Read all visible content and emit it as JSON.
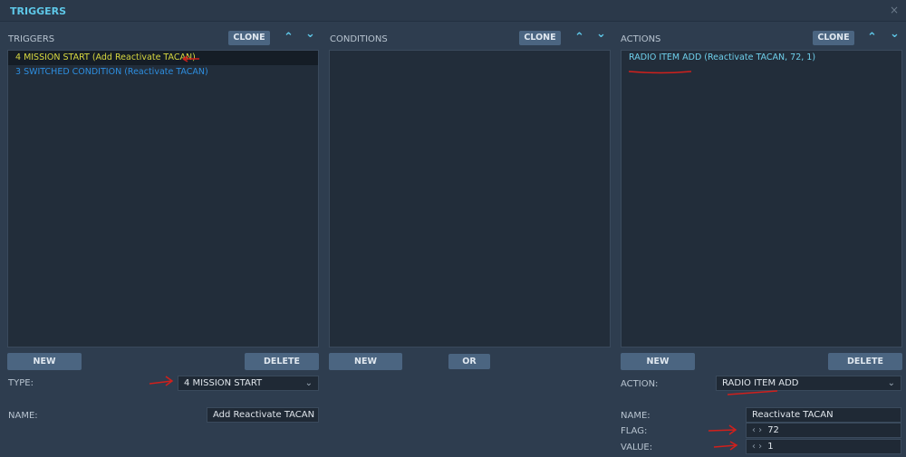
{
  "window": {
    "title": "TRIGGERS",
    "close": "×"
  },
  "triggers": {
    "header": "TRIGGERS",
    "clone": "CLONE",
    "up": "⌃",
    "down": "⌄",
    "items": [
      {
        "label": "4 MISSION START (Add Reactivate TACAN)"
      },
      {
        "label": "3 SWITCHED CONDITION (Reactivate TACAN)"
      }
    ],
    "new": "NEW",
    "delete": "DELETE",
    "type_label": "TYPE:",
    "type_value": "4 MISSION START",
    "name_label": "NAME:",
    "name_value": "Add Reactivate TACAN"
  },
  "conditions": {
    "header": "CONDITIONS",
    "clone": "CLONE",
    "up": "⌃",
    "down": "⌄",
    "new": "NEW",
    "or": "OR"
  },
  "actions": {
    "header": "ACTIONS",
    "clone": "CLONE",
    "up": "⌃",
    "down": "⌄",
    "items": [
      {
        "label": "RADIO ITEM ADD (Reactivate TACAN, 72, 1)"
      }
    ],
    "new": "NEW",
    "delete": "DELETE",
    "action_label": "ACTION:",
    "action_value": "RADIO ITEM ADD",
    "name_label": "NAME:",
    "name_value": "Reactivate TACAN",
    "flag_label": "FLAG:",
    "flag_value": "72",
    "value_label": "VALUE:",
    "value_value": "1",
    "spin": "‹ ›"
  },
  "colors": {
    "accent": "#5ec8e8",
    "selected": "#d8d840",
    "item": "#2d8ee0",
    "annotation": "#d0201c"
  }
}
